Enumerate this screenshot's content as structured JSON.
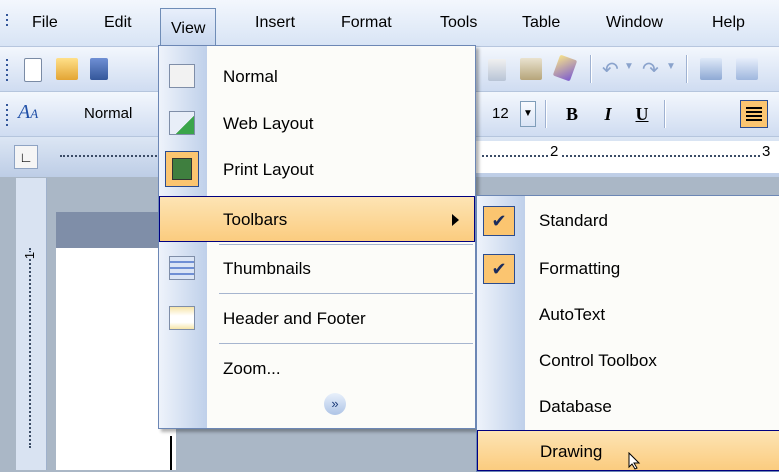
{
  "menubar": {
    "items": [
      {
        "label": "File"
      },
      {
        "label": "Edit"
      },
      {
        "label": "View"
      },
      {
        "label": "Insert"
      },
      {
        "label": "Format"
      },
      {
        "label": "Tools"
      },
      {
        "label": "Table"
      },
      {
        "label": "Window"
      },
      {
        "label": "Help"
      }
    ]
  },
  "formatting_toolbar": {
    "style_value": "Normal",
    "font_size_value": "12",
    "bold_label": "B",
    "italic_label": "I",
    "underline_label": "U"
  },
  "ruler": {
    "marks": [
      "2",
      "3"
    ],
    "left_mark": "1"
  },
  "view_menu": {
    "items": [
      {
        "label": "Normal"
      },
      {
        "label": "Web Layout"
      },
      {
        "label": "Print Layout"
      },
      {
        "label": "Toolbars"
      },
      {
        "label": "Thumbnails"
      },
      {
        "label": "Header and Footer"
      },
      {
        "label": "Zoom..."
      }
    ],
    "expand_glyph": "»"
  },
  "toolbars_submenu": {
    "items": [
      {
        "label": "Standard",
        "checked": true
      },
      {
        "label": "Formatting",
        "checked": true
      },
      {
        "label": "AutoText",
        "checked": false
      },
      {
        "label": "Control Toolbox",
        "checked": false
      },
      {
        "label": "Database",
        "checked": false
      },
      {
        "label": "Drawing",
        "checked": false
      }
    ],
    "check_glyph": "✔"
  },
  "colors": {
    "highlight": "#fbcc7f",
    "menubar": "#d8e4f5",
    "border": "#6c87b5"
  }
}
